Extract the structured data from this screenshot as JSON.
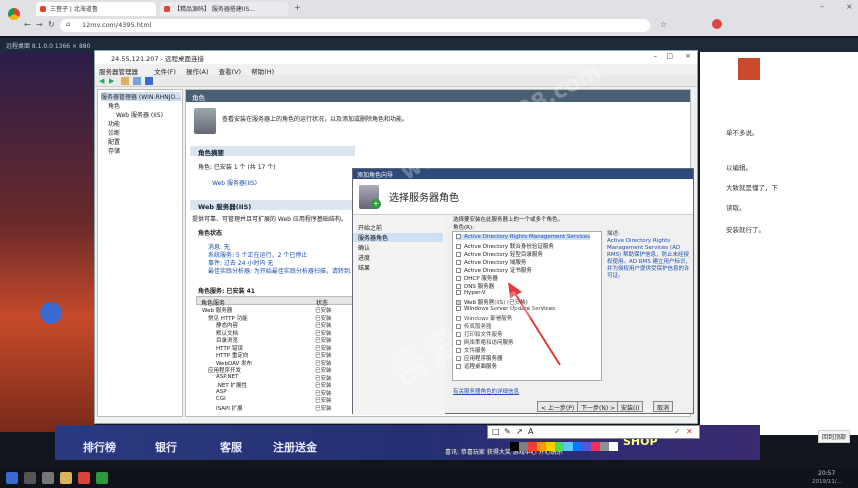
{
  "browser": {
    "tabs": [
      {
        "label": "三菩子 | 北海道鲁"
      },
      {
        "label": "【精品源码】 服务器搭建IIS..."
      }
    ],
    "new_tab": "+",
    "address": "12mv.com/4395.html"
  },
  "remote": {
    "bar_title": "远程桌面 8.1.0.0",
    "resolution": "1366 × 880"
  },
  "server_manager": {
    "title": "24.55.121.207 - 远程桌面连接",
    "inner_title": "服务器管理器",
    "menu": [
      "文件(F)",
      "操作(A)",
      "查看(V)",
      "帮助(H)"
    ],
    "tree": [
      {
        "label": "服务器管理器 (WIN-RHNJO..."
      },
      {
        "label": "角色"
      },
      {
        "label": "Web 服务器 (IIS)"
      },
      {
        "label": "功能"
      },
      {
        "label": "诊断"
      },
      {
        "label": "配置"
      },
      {
        "label": "存储"
      }
    ],
    "content_header": "角色",
    "intro": "查看安装在服务器上的角色的运行状况，以及添加或删除角色和功能。",
    "roles_summary": "角色摘要",
    "roles_count": "角色: 已安装 1 个 (共 17 个)",
    "role_web": "Web 服务器(IIS)",
    "section_web": "Web 服务器(IIS)",
    "web_desc": "提供可靠、可管理并且可扩展的 Web 应用程序基础结构。",
    "role_status": "角色状态",
    "messages": "消息: 无",
    "system_services": "系统服务: 5 个正在运行，2 个已停止",
    "events": "事件: 过去 24 小时内 无",
    "best_practices": "最佳实践分析器: 为开始最佳实践分析器扫描，请转到...",
    "role_services": "角色服务: 已安装 41",
    "table_headers": [
      "角色服务",
      "状态"
    ],
    "table_rows": [
      {
        "name": "Web 服务器",
        "status": "已安装"
      },
      {
        "name": "常见 HTTP 功能",
        "status": "已安装"
      },
      {
        "name": "静态内容",
        "status": "已安装"
      },
      {
        "name": "默认文档",
        "status": "已安装"
      },
      {
        "name": "目录浏览",
        "status": "已安装"
      },
      {
        "name": "HTTP 错误",
        "status": "已安装"
      },
      {
        "name": "HTTP 重定向",
        "status": "已安装"
      },
      {
        "name": "WebDAV 发布",
        "status": "已安装"
      },
      {
        "name": "应用程序开发",
        "status": "已安装"
      },
      {
        "name": "ASP.NET",
        "status": "已安装"
      },
      {
        "name": ".NET 扩展性",
        "status": "已安装"
      },
      {
        "name": "ASP",
        "status": "已安装"
      },
      {
        "name": "CGI",
        "status": "已安装"
      },
      {
        "name": "ISAPI 扩展",
        "status": "已安装"
      }
    ]
  },
  "wizard": {
    "title": "添加角色向导",
    "heading": "选择服务器角色",
    "steps": [
      "开始之前",
      "服务器角色",
      "确认",
      "进度",
      "结果"
    ],
    "prompt": "选择要安装在此服务器上的一个或多个角色。",
    "roles_label": "角色(R):",
    "roles": [
      "Active Directory Rights Management Services",
      "Active Directory 联合身份验证服务",
      "Active Directory 轻型目录服务",
      "Active Directory 域服务",
      "Active Directory 证书服务",
      "DHCP 服务器",
      "DNS 服务器",
      "Hyper-V",
      "Web 服务器(IIS) (已安装)",
      "Windows Server Update Services",
      "Windows 部署服务",
      "传真服务器",
      "打印和文件服务",
      "网络策略和访问服务",
      "文件服务",
      "应用程序服务器",
      "远程桌面服务"
    ],
    "desc_title": "描述:",
    "desc": "Active Directory Rights Management Services (AD RMS) 帮助保护信息，防止未经授权使用。AD RMS 建立用户标识，并为授权用户提供受保护信息的许可证。",
    "more_info": "有关服务器角色的详细信息",
    "buttons": [
      "< 上一步(P)",
      "下一步(N) >",
      "安装(I)",
      "取消"
    ]
  },
  "right_page": {
    "lines": [
      "单不多说。",
      "",
      "以编辑。",
      "大致就是懂了，下",
      "",
      "读取。",
      "",
      "安装就行了。"
    ],
    "button": "回到顶部"
  },
  "game": {
    "menu": [
      "排行榜",
      "银行",
      "客服",
      "注册送金"
    ],
    "ticker": "喜讯: 恭喜玩家 获得大奖 游戏中心 开心玩乐",
    "shop": "SHOP"
  },
  "taskbar": {
    "time": "20:57",
    "date": "2019/11/..."
  },
  "watermark": "吾爱源码网",
  "watermark2": "www.wosu98.com",
  "colors": {
    "annot_palette": [
      "#000000",
      "#7f7f7f",
      "#ff3b30",
      "#ff9500",
      "#ffcc00",
      "#4cd964",
      "#5ac8fa",
      "#007aff",
      "#5856d6",
      "#ff2d55",
      "#8e8e93",
      "#ffffff"
    ]
  }
}
